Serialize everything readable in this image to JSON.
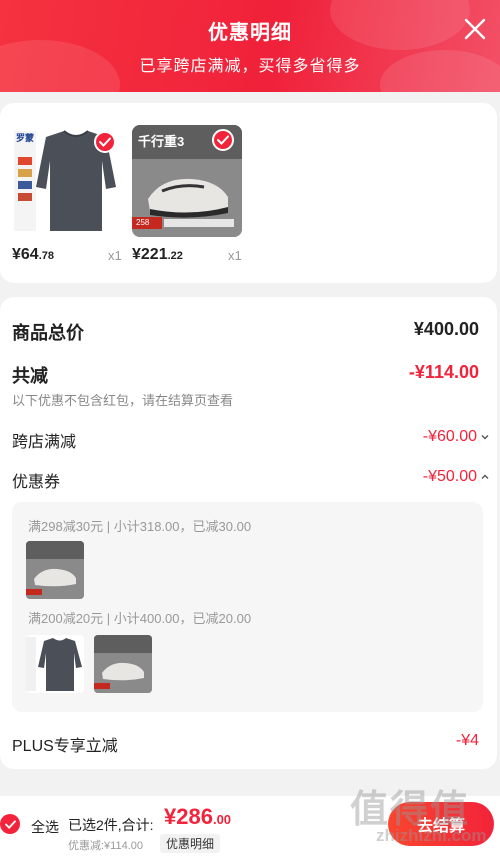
{
  "header": {
    "title": "优惠明细",
    "subtitle": "已享跨店满减，买得多省得多"
  },
  "products": [
    {
      "price_main": "¥64",
      "price_cents": ".78",
      "qty": "x1",
      "brand_label": "罗蒙"
    },
    {
      "price_main": "¥221",
      "price_cents": ".22",
      "qty": "x1",
      "banner_text": "千行重3",
      "tag": "258"
    }
  ],
  "summary": {
    "total_label": "商品总价",
    "total_value": "¥400.00",
    "reduce_label": "共减",
    "reduce_value": "-¥114.00",
    "note": "以下优惠不包含红包，请在结算页查看",
    "crossstore_label": "跨店满减",
    "crossstore_value": "-¥60.00",
    "coupon_label": "优惠券",
    "coupon_value": "-¥50.00",
    "plus_label": "PLUS专享立减",
    "plus_value": "-¥4"
  },
  "coupons": [
    {
      "text": "满298减30元 | 小计318.00，已减30.00"
    },
    {
      "text": "满200减20元 | 小计400.00，已减20.00"
    }
  ],
  "bottom_bar": {
    "select_all": "全选",
    "selected_label": "已选2件,合计:",
    "total_main": "¥286",
    "total_cents": ".00",
    "discount_text": "优惠减:¥114.00",
    "detail_button": "优惠明细",
    "checkout_button": "去结算"
  },
  "watermark": {
    "text": "值得值",
    "url": "zhizhizhi.com"
  },
  "colors": {
    "accent": "#f2233a",
    "header_start": "#f5323f",
    "header_end": "#f25066"
  }
}
